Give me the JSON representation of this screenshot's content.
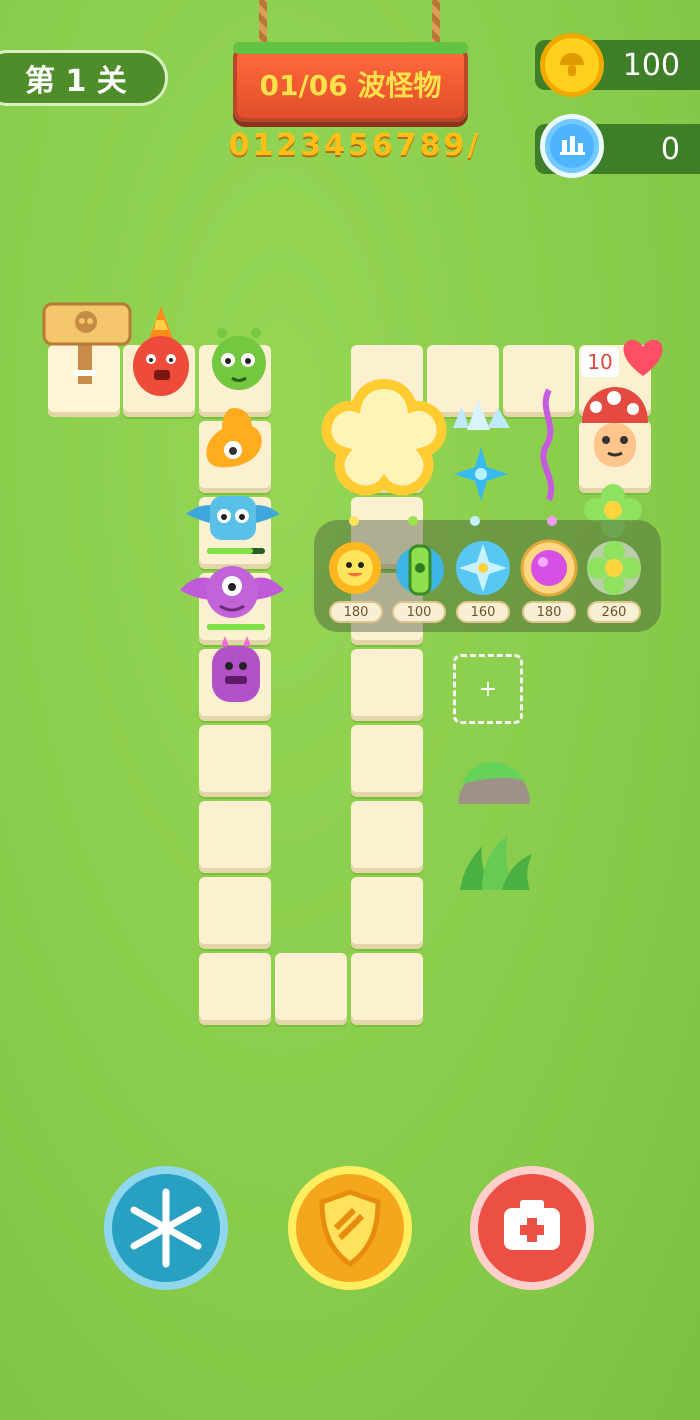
{
  "header": {
    "level_label": "第 1 关",
    "wave_text": "01/06 波怪物",
    "digits_text": "0123456789/",
    "coins_value": "100",
    "score_value": "0"
  },
  "base": {
    "hearts_value": "10"
  },
  "tower_menu": {
    "items": [
      {
        "icon": "sunflower-icon",
        "price": "180"
      },
      {
        "icon": "green-bottle-icon",
        "price": "100"
      },
      {
        "icon": "ice-crystal-icon",
        "price": "160"
      },
      {
        "icon": "purple-orb-icon",
        "price": "180"
      },
      {
        "icon": "green-flower-icon",
        "price": "260"
      }
    ]
  },
  "build_slot": {
    "label": "+"
  },
  "bottom_buttons": [
    {
      "name": "freeze-button",
      "icon": "snowflake-icon",
      "color": "#2c9fc4"
    },
    {
      "name": "shield-button",
      "icon": "shield-icon",
      "color": "#f3ac1e"
    },
    {
      "name": "heal-button",
      "icon": "medkit-icon",
      "color": "#ee5448"
    }
  ]
}
